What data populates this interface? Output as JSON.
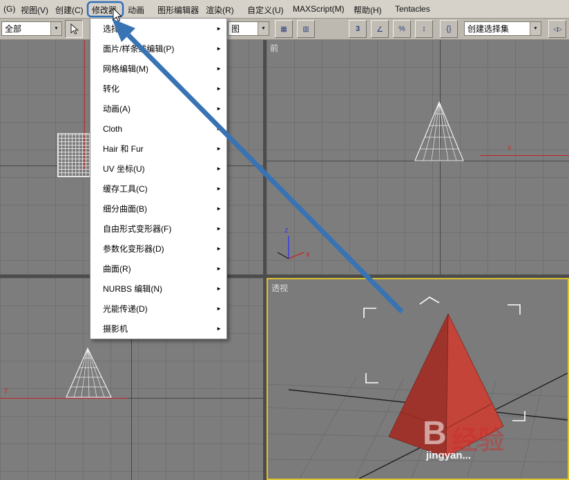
{
  "menubar": {
    "items": [
      {
        "label": "(G)"
      },
      {
        "label": "视图(V)"
      },
      {
        "label": "创建(C)"
      },
      {
        "label": "修改器",
        "active": true
      },
      {
        "label": "动画"
      },
      {
        "label": "图形编辑器"
      },
      {
        "label": "渲染(R)"
      },
      {
        "label": "自定义(U)"
      },
      {
        "label": "MAXScript(M)"
      },
      {
        "label": "帮助(H)"
      },
      {
        "label": "Tentacles"
      }
    ]
  },
  "toolbar": {
    "selection_filter_value": "全部",
    "view_value": "图",
    "named_selection_value": "创建选择集"
  },
  "modifier_menu": {
    "items": [
      {
        "label": "选择(S)"
      },
      {
        "label": "面片/样条线编辑(P)"
      },
      {
        "label": "网格编辑(M)"
      },
      {
        "label": "转化"
      },
      {
        "label": "动画(A)"
      },
      {
        "label": "Cloth"
      },
      {
        "label": "Hair 和 Fur"
      },
      {
        "label": "UV 坐标(U)"
      },
      {
        "label": "缓存工具(C)"
      },
      {
        "label": "细分曲面(B)"
      },
      {
        "label": "自由形式变形器(F)"
      },
      {
        "label": "参数化变形器(D)"
      },
      {
        "label": "曲面(R)"
      },
      {
        "label": "NURBS 编辑(N)"
      },
      {
        "label": "光能传递(D)"
      },
      {
        "label": "摄影机"
      }
    ]
  },
  "viewports": {
    "front_label": "前",
    "perspective_label": "透视",
    "front_axis_x": "x",
    "left_axis_y": "y",
    "tripod_z": "z",
    "tripod_x": "x"
  },
  "watermark": {
    "ghost_letter": "B",
    "red_text": "经验",
    "text": "jingyan..."
  },
  "icons": {
    "dropdown_arrow": "▼",
    "submenu_arrow": "►",
    "snap_3d": "3",
    "snap_angle": "∠",
    "snap_percent": "%",
    "snap_spinner": "↕",
    "named_sets": "{}",
    "mirror": "◁▷",
    "region_select": "▦",
    "window_crossing": "▥"
  },
  "colors": {
    "annotation_blue": "#3873b4",
    "active_viewport_border": "#ddc32e",
    "pyramid_red": "#c5443a",
    "menu_bg": "#ffffff",
    "viewport_bg": "#7d7d7d"
  }
}
